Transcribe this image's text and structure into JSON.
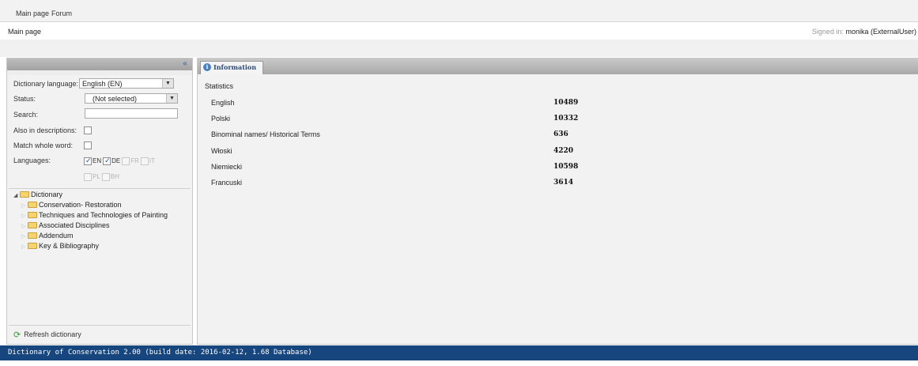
{
  "topnav": {
    "items": [
      {
        "label": "Main page"
      },
      {
        "label": "Forum"
      }
    ]
  },
  "breadcrumb": {
    "current": "Main page"
  },
  "user": {
    "signed_in_label": "Signed in:",
    "name": "monika (ExternalUser)"
  },
  "filters": {
    "dictionary_language": {
      "label": "Dictionary language:",
      "value": "English (EN)"
    },
    "status": {
      "label": "Status:",
      "value": "(Not selected)"
    },
    "search": {
      "label": "Search:",
      "value": ""
    },
    "also_in_descriptions": {
      "label": "Also in descriptions:",
      "checked": false
    },
    "match_whole_word": {
      "label": "Match whole word:",
      "checked": false
    },
    "languages": {
      "label": "Languages:",
      "options": [
        {
          "code": "EN",
          "checked": true,
          "enabled": true
        },
        {
          "code": "DE",
          "checked": true,
          "enabled": true
        },
        {
          "code": "FR",
          "checked": false,
          "enabled": false
        },
        {
          "code": "IT",
          "checked": false,
          "enabled": false
        },
        {
          "code": "PL",
          "checked": false,
          "enabled": false
        },
        {
          "code": "BH",
          "checked": false,
          "enabled": false
        }
      ]
    }
  },
  "tree": {
    "root": "Dictionary",
    "children": [
      "Conservation- Restoration",
      "Techniques and Technologies of Painting",
      "Associated Disciplines",
      "Addendum",
      "Key & Bibliography"
    ]
  },
  "refresh_label": "Refresh dictionary",
  "tab": {
    "label": "Information",
    "icon": "info-icon"
  },
  "statistics": {
    "title": "Statistics",
    "rows": [
      {
        "name": "English",
        "value": "10489"
      },
      {
        "name": "Polski",
        "value": "10332"
      },
      {
        "name": "Binominal names/ Historical Terms",
        "value": "636"
      },
      {
        "name": "Włoski",
        "value": "4220"
      },
      {
        "name": "Niemiecki",
        "value": "10598"
      },
      {
        "name": "Francuski",
        "value": "3614"
      }
    ]
  },
  "status_bar": "Dictionary of Conservation 2.00 (build date: 2016-02-12, 1.68 Database)",
  "colors": {
    "status_bar_bg": "#17457d",
    "folder": "#f6d36e",
    "info_icon": "#4a7fc4"
  }
}
